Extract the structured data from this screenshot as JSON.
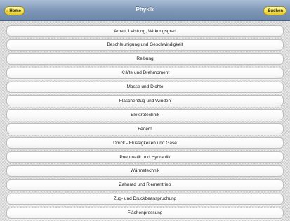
{
  "nav": {
    "title": "Physik",
    "home_label": "Home",
    "search_label": "Suchen",
    "button_color": "#f4e04a",
    "bar_color": "#7f98b8"
  },
  "topics": [
    "Arbeit, Leistung, Wirkungsgrad",
    "Beschleunigung und Geschwindigkeit",
    "Reibung",
    "Kräfte und Drehmoment",
    "Masse und Dichte",
    "Flaschenzug und Winden",
    "Elektrotechnik",
    "Federn",
    "Druck - Flüssigkeiten und Gase",
    "Pneumatik und Hydraulik",
    "Wärmetechnik",
    "Zahnrad und Riementrieb",
    "Zug- und Druckbeanspruchung",
    "Flächenpressung"
  ]
}
